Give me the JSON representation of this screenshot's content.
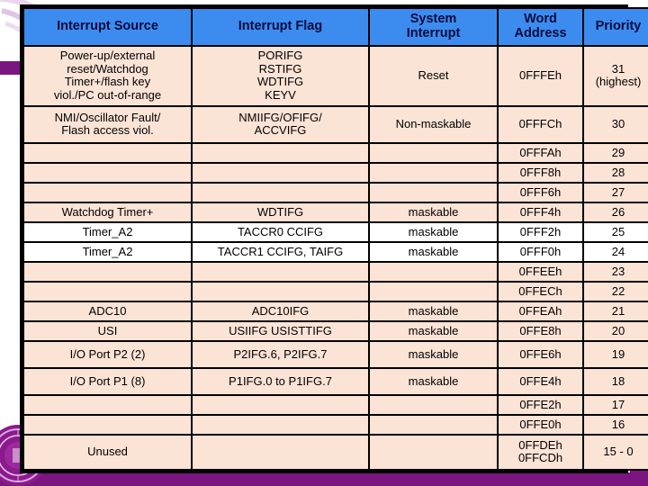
{
  "slide": {
    "theme": {
      "header_blue": "#3C8CF0",
      "row_pink": "#FBE3D6",
      "row_white": "#FFFFFF",
      "accent_purple": "#7B1580",
      "border_black": "#000000",
      "header_text": "#0A0A3C"
    },
    "decorations": {
      "left_bar": "purple-accent-bar",
      "right_bar": "purple-accent-bar",
      "bottom_band": "purple-footer-band",
      "seal": "university-seal-watermark",
      "swoosh": "lavender-swoosh-graphic"
    }
  },
  "table": {
    "headers": [
      "Interrupt Source",
      "Interrupt Flag",
      "System Interrupt",
      "Word Address",
      "Priority"
    ],
    "headers_wrapped": [
      [
        "Interrupt Source"
      ],
      [
        "Interrupt Flag"
      ],
      [
        "System",
        "Interrupt"
      ],
      [
        "Word",
        "Address"
      ],
      [
        "Priority"
      ]
    ],
    "rows": [
      {
        "source": "Power-up/external reset/Watchdog Timer+/flash key viol./PC out-of-range",
        "source_lines": [
          "Power-up/external",
          "reset/Watchdog",
          "Timer+/flash key",
          "viol./PC out-of-range"
        ],
        "flag": "PORIFG RSTIFG WDTIFG KEYV",
        "flag_lines": [
          "PORIFG",
          "RSTIFG",
          "WDTIFG",
          "KEYV"
        ],
        "system_interrupt": "Reset",
        "word_address": "0FFFEh",
        "word_address_lines": [
          "0FFFEh"
        ],
        "priority": "31 (highest)",
        "priority_lines": [
          "31",
          "(highest)"
        ],
        "style": "pink",
        "height": "tall4"
      },
      {
        "source": "NMI/Oscillator Fault/ Flash access viol.",
        "source_lines": [
          "NMI/Oscillator Fault/",
          "Flash access viol."
        ],
        "flag": "NMIIFG/OFIFG/ ACCVIFG",
        "flag_lines": [
          "NMIIFG/OFIFG/",
          "ACCVIFG"
        ],
        "system_interrupt": "Non-maskable",
        "word_address": "0FFFCh",
        "word_address_lines": [
          "0FFFCh"
        ],
        "priority": "30",
        "priority_lines": [
          "30"
        ],
        "style": "pink",
        "height": "tall2"
      },
      {
        "source": "",
        "source_lines": [
          ""
        ],
        "flag": "",
        "flag_lines": [
          ""
        ],
        "system_interrupt": "",
        "word_address": "0FFFAh",
        "word_address_lines": [
          "0FFFAh"
        ],
        "priority": "29",
        "priority_lines": [
          "29"
        ],
        "style": "pink",
        "height": "norm"
      },
      {
        "source": "",
        "source_lines": [
          ""
        ],
        "flag": "",
        "flag_lines": [
          ""
        ],
        "system_interrupt": "",
        "word_address": "0FFF8h",
        "word_address_lines": [
          "0FFF8h"
        ],
        "priority": "28",
        "priority_lines": [
          "28"
        ],
        "style": "pink",
        "height": "norm"
      },
      {
        "source": "",
        "source_lines": [
          ""
        ],
        "flag": "",
        "flag_lines": [
          ""
        ],
        "system_interrupt": "",
        "word_address": "0FFF6h",
        "word_address_lines": [
          "0FFF6h"
        ],
        "priority": "27",
        "priority_lines": [
          "27"
        ],
        "style": "pink",
        "height": "norm"
      },
      {
        "source": "Watchdog Timer+",
        "source_lines": [
          "Watchdog Timer+"
        ],
        "flag": "WDTIFG",
        "flag_lines": [
          "WDTIFG"
        ],
        "system_interrupt": "maskable",
        "word_address": "0FFF4h",
        "word_address_lines": [
          "0FFF4h"
        ],
        "priority": "26",
        "priority_lines": [
          "26"
        ],
        "style": "pink",
        "height": "norm"
      },
      {
        "source": "Timer_A2",
        "source_lines": [
          "Timer_A2"
        ],
        "flag": "TACCR0 CCIFG",
        "flag_lines": [
          "TACCR0 CCIFG"
        ],
        "system_interrupt": "maskable",
        "word_address": "0FFF2h",
        "word_address_lines": [
          "0FFF2h"
        ],
        "priority": "25",
        "priority_lines": [
          "25"
        ],
        "style": "white",
        "height": "norm"
      },
      {
        "source": "Timer_A2",
        "source_lines": [
          "Timer_A2"
        ],
        "flag": "TACCR1 CCIFG, TAIFG",
        "flag_lines": [
          "TACCR1 CCIFG, TAIFG"
        ],
        "system_interrupt": "maskable",
        "word_address": "0FFF0h",
        "word_address_lines": [
          "0FFF0h"
        ],
        "priority": "24",
        "priority_lines": [
          "24"
        ],
        "style": "white",
        "height": "norm"
      },
      {
        "source": "",
        "source_lines": [
          ""
        ],
        "flag": "",
        "flag_lines": [
          ""
        ],
        "system_interrupt": "",
        "word_address": "0FFEEh",
        "word_address_lines": [
          "0FFEEh"
        ],
        "priority": "23",
        "priority_lines": [
          "23"
        ],
        "style": "pink",
        "height": "norm"
      },
      {
        "source": "",
        "source_lines": [
          ""
        ],
        "flag": "",
        "flag_lines": [
          ""
        ],
        "system_interrupt": "",
        "word_address": "0FFECh",
        "word_address_lines": [
          "0FFECh"
        ],
        "priority": "22",
        "priority_lines": [
          "22"
        ],
        "style": "pink",
        "height": "norm"
      },
      {
        "source": "ADC10",
        "source_lines": [
          "ADC10"
        ],
        "flag": "ADC10IFG",
        "flag_lines": [
          "ADC10IFG"
        ],
        "system_interrupt": "maskable",
        "word_address": "0FFEAh",
        "word_address_lines": [
          "0FFEAh"
        ],
        "priority": "21",
        "priority_lines": [
          "21"
        ],
        "style": "pink",
        "height": "norm"
      },
      {
        "source": "USI",
        "source_lines": [
          "USI"
        ],
        "flag": "USIIFG USISTTIFG",
        "flag_lines": [
          "USIIFG USISTTIFG"
        ],
        "system_interrupt": "maskable",
        "word_address": "0FFE8h",
        "word_address_lines": [
          "0FFE8h"
        ],
        "priority": "20",
        "priority_lines": [
          "20"
        ],
        "style": "pink",
        "height": "norm"
      },
      {
        "source": "I/O Port P2 (2)",
        "source_lines": [
          "I/O Port P2 (2)"
        ],
        "flag": "P2IFG.6, P2IFG.7",
        "flag_lines": [
          "P2IFG.6, P2IFG.7"
        ],
        "system_interrupt": "maskable",
        "word_address": "0FFE6h",
        "word_address_lines": [
          "0FFE6h"
        ],
        "priority": "19",
        "priority_lines": [
          "19"
        ],
        "style": "pink",
        "height": "med"
      },
      {
        "source": "I/O Port P1 (8)",
        "source_lines": [
          "I/O Port P1 (8)"
        ],
        "flag": "P1IFG.0 to P1IFG.7",
        "flag_lines": [
          "P1IFG.0 to P1IFG.7"
        ],
        "system_interrupt": "maskable",
        "word_address": "0FFE4h",
        "word_address_lines": [
          "0FFE4h"
        ],
        "priority": "18",
        "priority_lines": [
          "18"
        ],
        "style": "pink",
        "height": "med"
      },
      {
        "source": "",
        "source_lines": [
          ""
        ],
        "flag": "",
        "flag_lines": [
          ""
        ],
        "system_interrupt": "",
        "word_address": "0FFE2h",
        "word_address_lines": [
          "0FFE2h"
        ],
        "priority": "17",
        "priority_lines": [
          "17"
        ],
        "style": "pink",
        "height": "norm"
      },
      {
        "source": "",
        "source_lines": [
          ""
        ],
        "flag": "",
        "flag_lines": [
          ""
        ],
        "system_interrupt": "",
        "word_address": "0FFE0h",
        "word_address_lines": [
          "0FFE0h"
        ],
        "priority": "16",
        "priority_lines": [
          "16"
        ],
        "style": "pink",
        "height": "norm"
      },
      {
        "source": "Unused",
        "source_lines": [
          "Unused"
        ],
        "flag": "",
        "flag_lines": [
          ""
        ],
        "system_interrupt": "",
        "word_address": "0FFDEh 0FFCDh",
        "word_address_lines": [
          "0FFDEh",
          "0FFCDh"
        ],
        "priority": "15 - 0",
        "priority_lines": [
          "15 - 0"
        ],
        "style": "pink",
        "height": "last"
      }
    ]
  }
}
